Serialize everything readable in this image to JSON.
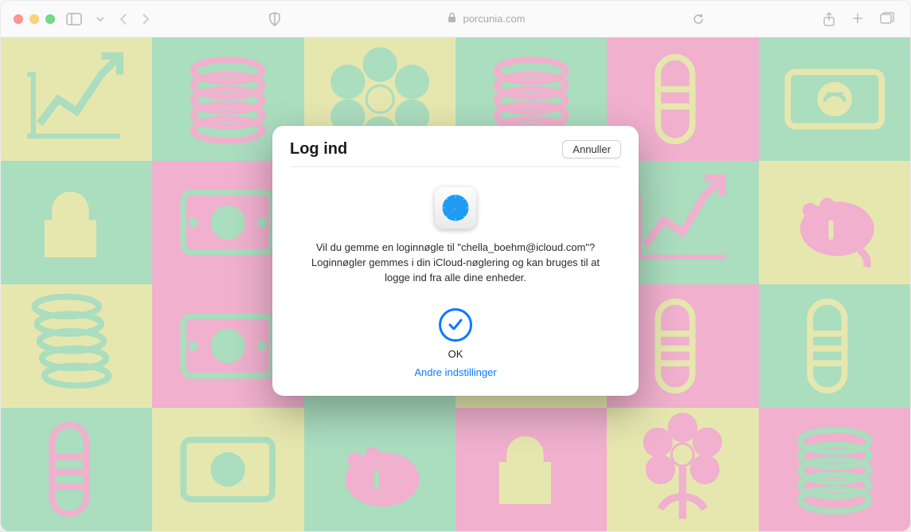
{
  "address_bar": {
    "domain": "porcunia.com"
  },
  "dialog": {
    "title": "Log ind",
    "cancel_label": "Annuller",
    "message": "Vil du gemme en loginnøgle til \"chella_boehm@icloud.com\"? Loginnøgler gemmes i din iCloud-nøglering og kan bruges til at logge ind fra alle dine enheder.",
    "ok_label": "OK",
    "other_settings_label": "Andre indstillinger"
  }
}
